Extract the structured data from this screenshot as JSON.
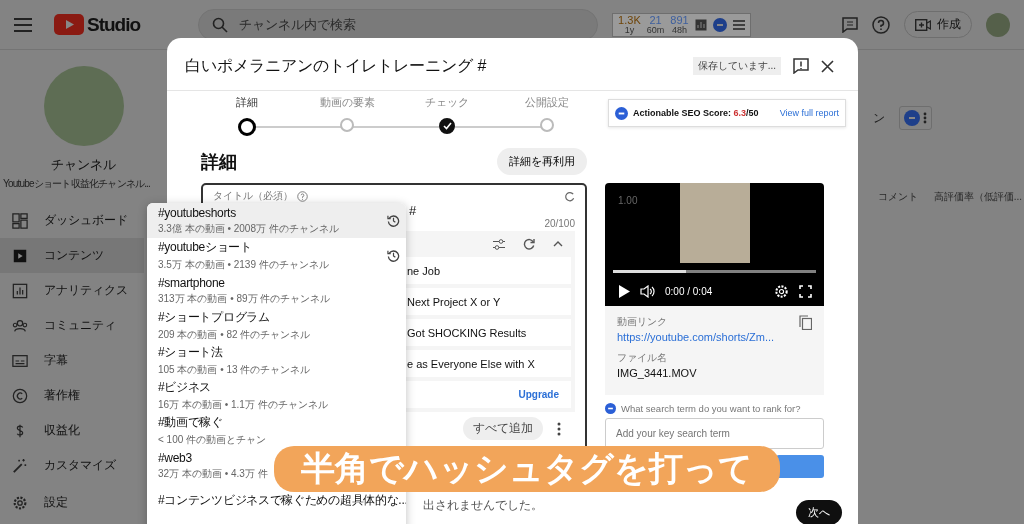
{
  "topbar": {
    "logo": "Studio",
    "search_placeholder": "チャンネル内で検索",
    "stats": [
      {
        "value": "1.3K",
        "sub": "1y",
        "color": "#6e4408"
      },
      {
        "value": "21",
        "sub": "60m",
        "color": "#3d5f9e"
      },
      {
        "value": "891",
        "sub": "48h",
        "color": "#3d5f9e"
      }
    ],
    "create": "作成"
  },
  "sidebar": {
    "channel_title": "チャンネル",
    "channel_subtitle": "Youtubeショート収益化チャンネル...",
    "items": [
      {
        "label": "ダッシュボード",
        "kind": "dashboard",
        "selected": false
      },
      {
        "label": "コンテンツ",
        "kind": "content",
        "selected": true
      },
      {
        "label": "アナリティクス",
        "kind": "analytics",
        "selected": false
      },
      {
        "label": "コミュニティ",
        "kind": "community",
        "selected": false
      },
      {
        "label": "字幕",
        "kind": "subtitles",
        "selected": false
      },
      {
        "label": "著作権",
        "kind": "copyright",
        "selected": false
      },
      {
        "label": "収益化",
        "kind": "monetization",
        "selected": false
      },
      {
        "label": "カスタマイズ",
        "kind": "customize",
        "selected": false
      }
    ],
    "settings": "設定"
  },
  "background": {
    "partial_label": "ン",
    "columns": [
      "コメント",
      "高評価率（低評価..."
    ]
  },
  "dialog": {
    "title": "白いポメラニアンのトイレトレーニング #",
    "saving_badge": "保存しています...",
    "steps": [
      {
        "label": "詳細",
        "current": true,
        "done": false
      },
      {
        "label": "動画の要素",
        "current": false,
        "done": false
      },
      {
        "label": "チェック",
        "current": false,
        "done": true
      },
      {
        "label": "公開設定",
        "current": false,
        "done": false
      }
    ],
    "seo": {
      "label": "Actionable SEO Score:",
      "score": "6.3",
      "total": "/50",
      "link": "View full report"
    },
    "heading": "詳細",
    "reuse_button": "詳細を再利用",
    "title_field": {
      "label": "タイトル（必須）",
      "value": "#",
      "counter": "20/100"
    },
    "suggestions": [
      "ne Job",
      "Next Project X or Y",
      "Got SHOCKING Results",
      "e as Everyone Else with X"
    ],
    "upgrade": "Upgrade",
    "add_all": "すべて追加",
    "notice": "出されませんでした。",
    "video": {
      "speed": "1.00",
      "level": 0.36,
      "time": "0:00 / 0:04"
    },
    "link_label": "動画リンク",
    "link": "https://youtube.com/shorts/Zm...",
    "file_label": "ファイル名",
    "file": "IMG_3441.MOV",
    "seo_question": "What search term do you want to rank for?",
    "keyword_placeholder": "Add your key search term",
    "next": "次へ"
  },
  "hashtag_dropdown": {
    "items": [
      {
        "tag": "#youtubeshorts",
        "stats": "3.3億 本の動画 • 2008万 件のチャンネル",
        "recent": true,
        "selected": true
      },
      {
        "tag": "#youtubeショート",
        "stats": "3.5万 本の動画 • 2139 件のチャンネル",
        "recent": true,
        "selected": false
      },
      {
        "tag": "#smartphone",
        "stats": "313万 本の動画 • 89万 件のチャンネル",
        "recent": false,
        "selected": false
      },
      {
        "tag": "#ショートプログラム",
        "stats": "209 本の動画 • 82 件のチャンネル",
        "recent": false,
        "selected": false
      },
      {
        "tag": "#ショート法",
        "stats": "105 本の動画 • 13 件のチャンネル",
        "recent": false,
        "selected": false
      },
      {
        "tag": "#ビジネス",
        "stats": "16万 本の動画 • 1.1万 件のチャンネル",
        "recent": false,
        "selected": false
      },
      {
        "tag": "#動画で稼ぐ",
        "stats": "< 100 件の動画とチャン",
        "recent": false,
        "selected": false
      },
      {
        "tag": "#web3",
        "stats": "32万 本の動画 • 4.3万 件",
        "recent": false,
        "selected": false
      },
      {
        "tag": "#コンテンツビジネスで稼ぐための超具体的な...",
        "recent": false,
        "selected": false
      }
    ]
  },
  "caption": "半角でハッシュタグを打って"
}
